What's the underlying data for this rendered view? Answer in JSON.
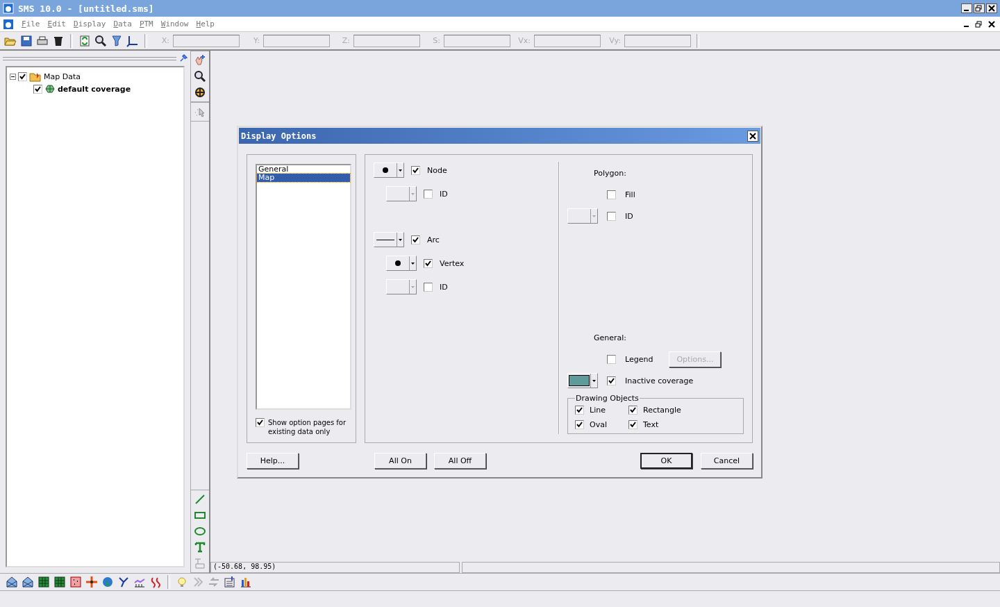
{
  "window": {
    "title": "SMS 10.0 - [untitled.sms]"
  },
  "menu": [
    "File",
    "Edit",
    "Display",
    "Data",
    "PTM",
    "Window",
    "Help"
  ],
  "coord_fields": [
    {
      "label": "X:"
    },
    {
      "label": "Y:"
    },
    {
      "label": "Z:"
    },
    {
      "label": "S:"
    },
    {
      "label": "Vx:"
    },
    {
      "label": "Vy:"
    }
  ],
  "tree": [
    {
      "label": "Map Data",
      "checked": true,
      "expanded": true,
      "children": [
        {
          "label": "default coverage",
          "checked": true
        }
      ]
    }
  ],
  "status_bar": {
    "coordinates": "(-50.68,  98.95)"
  },
  "dialog": {
    "title": "Display Options",
    "pages": [
      {
        "label": "General",
        "selected": false
      },
      {
        "label": "Map",
        "selected": true
      }
    ],
    "existing_only": {
      "label": "Show option pages for existing data only",
      "checked": true
    },
    "map_options": [
      {
        "label": "Node",
        "checked": true,
        "kind": "dot",
        "children": [
          {
            "label": "ID",
            "checked": false,
            "kind": "blank"
          }
        ]
      },
      {
        "label": "Arc",
        "checked": true,
        "kind": "line",
        "children": [
          {
            "label": "Vertex",
            "checked": true,
            "kind": "dot"
          },
          {
            "label": "ID",
            "checked": false,
            "kind": "blank"
          }
        ]
      }
    ],
    "polygon": {
      "heading": "Polygon:",
      "options": [
        {
          "label": "Fill",
          "checked": false,
          "kind": "none"
        },
        {
          "label": "ID",
          "checked": false,
          "kind": "blank"
        }
      ]
    },
    "general": {
      "heading": "General:",
      "legend": {
        "label": "Legend",
        "checked": false
      },
      "options_button": {
        "label": "Options...",
        "disabled": true
      },
      "inactive": {
        "label": "Inactive coverage",
        "checked": true,
        "color": "#5f9b9b"
      }
    },
    "drawing_objects": {
      "title": "Drawing Objects",
      "items": [
        {
          "label": "Line",
          "checked": true
        },
        {
          "label": "Rectangle",
          "checked": true
        },
        {
          "label": "Oval",
          "checked": true
        },
        {
          "label": "Text",
          "checked": true
        }
      ]
    },
    "buttons": [
      {
        "label": "Help...",
        "default": false
      },
      {
        "label": "All On",
        "default": false
      },
      {
        "label": "All Off",
        "default": false
      },
      {
        "label": "OK",
        "default": true
      },
      {
        "label": "Cancel",
        "default": false
      }
    ]
  }
}
